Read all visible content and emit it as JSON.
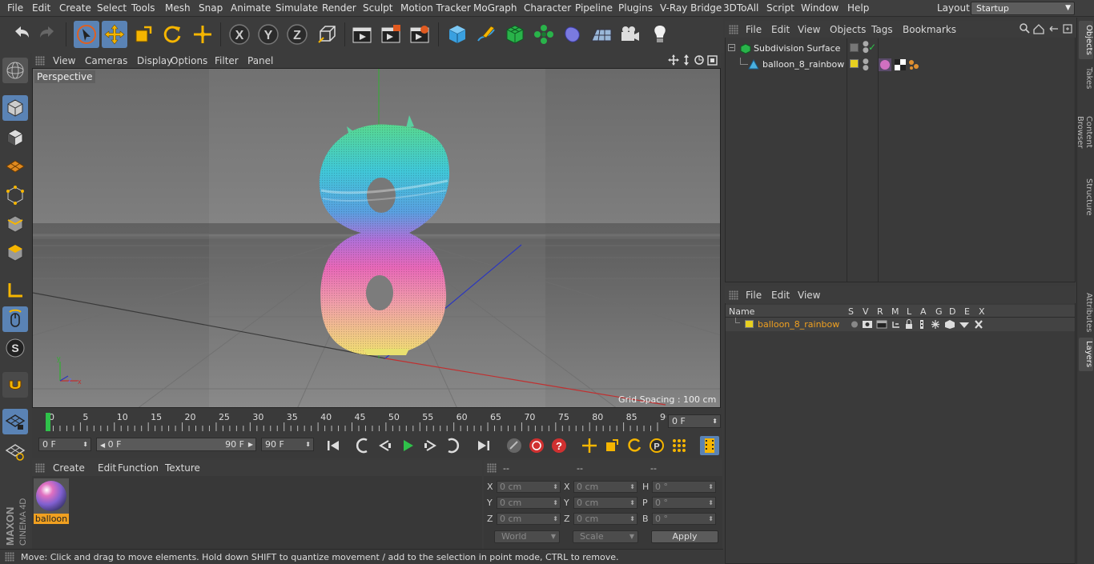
{
  "menubar": {
    "items": [
      "File",
      "Edit",
      "Create",
      "Select",
      "Tools",
      "Mesh",
      "Snap",
      "Animate",
      "Simulate",
      "Render",
      "Sculpt",
      "Motion Tracker",
      "MoGraph",
      "Character",
      "Pipeline",
      "Plugins",
      "V-Ray Bridge",
      "3DToAll",
      "Script",
      "Window",
      "Help"
    ],
    "layout_label": "Layout:",
    "layout_value": "Startup"
  },
  "toolbar": {
    "icons": [
      "undo-icon",
      "redo-icon",
      "select-arrow-icon",
      "move-icon",
      "scale-icon",
      "rotate-icon",
      "live-selection-icon",
      "x-axis-icon",
      "y-axis-icon",
      "z-axis-icon",
      "coordinate-system-icon",
      "render-view-icon",
      "render-picture-viewer-icon",
      "render-settings-icon",
      "cube-icon",
      "pen-icon",
      "subdivision-icon",
      "mograph-cloner-icon",
      "deformer-icon",
      "floor-icon",
      "camera-icon",
      "light-icon"
    ],
    "axis_labels": [
      "X",
      "Y",
      "Z"
    ]
  },
  "viewport": {
    "menu": [
      "View",
      "Cameras",
      "Display",
      "Options",
      "Filter",
      "Panel"
    ],
    "camera_label": "Perspective",
    "grid_spacing": "Grid Spacing : 100 cm"
  },
  "timeline": {
    "ticks": [
      "0",
      "5",
      "10",
      "15",
      "20",
      "25",
      "30",
      "35",
      "40",
      "45",
      "50",
      "55",
      "60",
      "65",
      "70",
      "75",
      "80",
      "85",
      "90"
    ],
    "current_frame": "0 F",
    "start_field": "0 F",
    "range_start": "0 F",
    "range_end": "90 F",
    "end_field": "90 F"
  },
  "material_manager": {
    "menu": [
      "Create",
      "Edit",
      "Function",
      "Texture"
    ],
    "materials": [
      {
        "name": "balloon"
      }
    ]
  },
  "coordinates": {
    "header": [
      "--",
      "--",
      "--"
    ],
    "rows": [
      {
        "a": "X",
        "av": "0 cm",
        "b": "X",
        "bv": "0 cm",
        "c": "H",
        "cv": "0 °"
      },
      {
        "a": "Y",
        "av": "0 cm",
        "b": "Y",
        "bv": "0 cm",
        "c": "P",
        "cv": "0 °"
      },
      {
        "a": "Z",
        "av": "0 cm",
        "b": "Z",
        "bv": "0 cm",
        "c": "B",
        "cv": "0 °"
      }
    ],
    "space": "World",
    "mode": "Scale",
    "apply": "Apply"
  },
  "status": "Move: Click and drag to move elements. Hold down SHIFT to quantize movement / add to the selection in point mode, CTRL to remove.",
  "object_manager": {
    "menu": [
      "File",
      "Edit",
      "View",
      "Objects",
      "Tags",
      "Bookmarks"
    ],
    "objects": [
      {
        "name": "Subdivision Surface",
        "level": 0
      },
      {
        "name": "balloon_8_rainbow",
        "level": 1
      }
    ]
  },
  "layer_manager": {
    "menu": [
      "File",
      "Edit",
      "View"
    ],
    "columns": [
      "Name",
      "S",
      "V",
      "R",
      "M",
      "L",
      "A",
      "G",
      "D",
      "E",
      "X"
    ],
    "layers": [
      {
        "name": "balloon_8_rainbow",
        "color": "#e8d020"
      }
    ]
  },
  "right_tabs": [
    "Objects",
    "Takes",
    "Content Browser",
    "Structure",
    "Attributes",
    "Layers"
  ],
  "branding": {
    "text": "MAXON CINEMA 4D"
  },
  "colors": {
    "accent": "#5a83b5",
    "selected_text": "#f0a020",
    "play": "#2fc24a",
    "record": "#d03030"
  }
}
